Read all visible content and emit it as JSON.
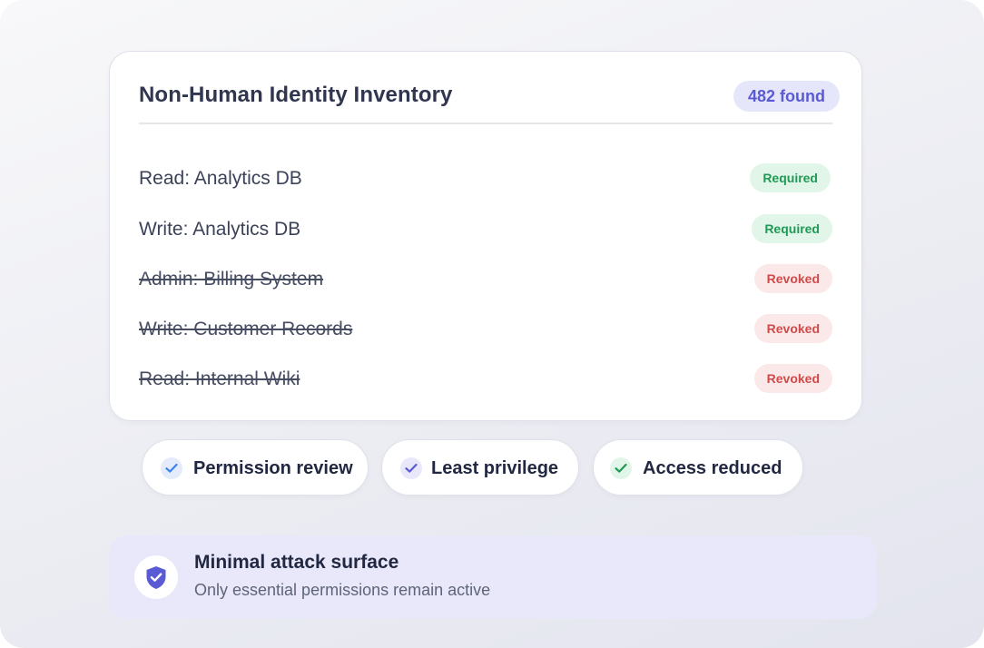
{
  "inventory": {
    "title": "Non-Human Identity Inventory",
    "count_label": "482 found",
    "permissions": [
      {
        "label": "Read: Analytics DB",
        "status": "Required",
        "revoked": false
      },
      {
        "label": "Write: Analytics DB",
        "status": "Required",
        "revoked": false
      },
      {
        "label": "Admin: Billing System",
        "status": "Revoked",
        "revoked": true
      },
      {
        "label": "Write: Customer Records",
        "status": "Revoked",
        "revoked": true
      },
      {
        "label": "Read: Internal Wiki",
        "status": "Revoked",
        "revoked": true
      }
    ]
  },
  "chips": [
    {
      "label": "Permission review",
      "icon": "check-icon",
      "color": "#3b82f6"
    },
    {
      "label": "Least privilege",
      "icon": "check-icon",
      "color": "#5a5bd4"
    },
    {
      "label": "Access reduced",
      "icon": "check-icon",
      "color": "#1f9a55"
    }
  ],
  "summary": {
    "icon": "shield-check-icon",
    "title": "Minimal attack surface",
    "subtitle": "Only essential permissions remain active",
    "accent": "#5a5bd4"
  },
  "colors": {
    "required_text": "#1f9a55",
    "required_bg": "#e2f5e9",
    "revoked_text": "#d14a4a",
    "revoked_bg": "#fbe8e8",
    "badge_text": "#5a5bd4",
    "badge_bg": "#e6e6fb"
  }
}
